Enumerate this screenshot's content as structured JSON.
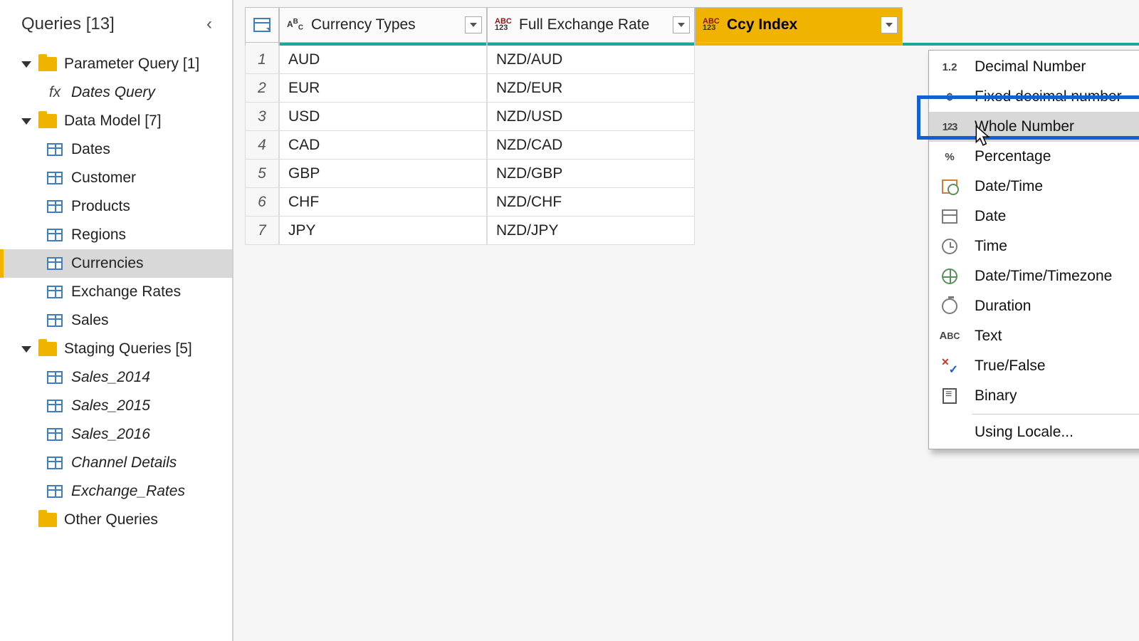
{
  "sidebar": {
    "title": "Queries [13]",
    "groups": [
      {
        "label": "Parameter Query [1]",
        "items": [
          {
            "label": "Dates Query",
            "italic": true,
            "icon": "fx"
          }
        ]
      },
      {
        "label": "Data Model [7]",
        "items": [
          {
            "label": "Dates"
          },
          {
            "label": "Customer"
          },
          {
            "label": "Products"
          },
          {
            "label": "Regions"
          },
          {
            "label": "Currencies",
            "selected": true
          },
          {
            "label": "Exchange Rates"
          },
          {
            "label": "Sales"
          }
        ]
      },
      {
        "label": "Staging Queries [5]",
        "items": [
          {
            "label": "Sales_2014",
            "italic": true
          },
          {
            "label": "Sales_2015",
            "italic": true
          },
          {
            "label": "Sales_2016",
            "italic": true
          },
          {
            "label": "Channel Details",
            "italic": true
          },
          {
            "label": "Exchange_Rates",
            "italic": true
          }
        ]
      }
    ],
    "other": "Other Queries"
  },
  "grid": {
    "columns": [
      {
        "name": "Currency Types",
        "type_icon": "ABC"
      },
      {
        "name": "Full Exchange Rate",
        "type_icon": "ABC123"
      },
      {
        "name": "Ccy Index",
        "type_icon": "ABC123",
        "selected": true
      }
    ],
    "rows": [
      {
        "n": "1",
        "c0": "AUD",
        "c1": "NZD/AUD"
      },
      {
        "n": "2",
        "c0": "EUR",
        "c1": "NZD/EUR"
      },
      {
        "n": "3",
        "c0": "USD",
        "c1": "NZD/USD"
      },
      {
        "n": "4",
        "c0": "CAD",
        "c1": "NZD/CAD"
      },
      {
        "n": "5",
        "c0": "GBP",
        "c1": "NZD/GBP"
      },
      {
        "n": "6",
        "c0": "CHF",
        "c1": "NZD/CHF"
      },
      {
        "n": "7",
        "c0": "JPY",
        "c1": "NZD/JPY"
      }
    ]
  },
  "type_menu": {
    "items": [
      {
        "label": "Decimal Number",
        "icon": "dec"
      },
      {
        "label": "Fixed decimal number",
        "icon": "dollar"
      },
      {
        "label": "Whole Number",
        "icon": "123",
        "hover": true,
        "highlighted": true
      },
      {
        "label": "Percentage",
        "icon": "pct"
      },
      {
        "label": "Date/Time",
        "icon": "dtcal"
      },
      {
        "label": "Date",
        "icon": "cal"
      },
      {
        "label": "Time",
        "icon": "clock"
      },
      {
        "label": "Date/Time/Timezone",
        "icon": "globe"
      },
      {
        "label": "Duration",
        "icon": "dur"
      },
      {
        "label": "Text",
        "icon": "text"
      },
      {
        "label": "True/False",
        "icon": "tf"
      },
      {
        "label": "Binary",
        "icon": "bin"
      }
    ],
    "locale": "Using Locale..."
  }
}
